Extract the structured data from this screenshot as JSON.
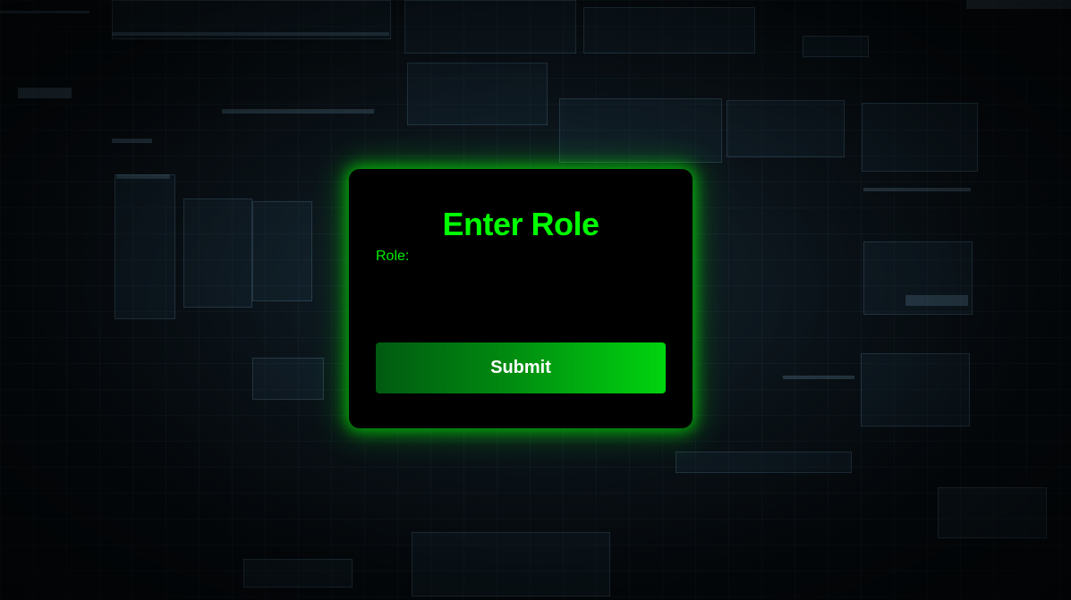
{
  "dialog": {
    "title": "Enter Role",
    "role_label": "Role:",
    "role_value": "",
    "submit_label": "Submit"
  },
  "colors": {
    "accent": "#00ff00",
    "modal_background": "#000000",
    "button_gradient_start": "#015a12",
    "button_gradient_end": "#00d40f",
    "button_text": "#ffffff"
  }
}
